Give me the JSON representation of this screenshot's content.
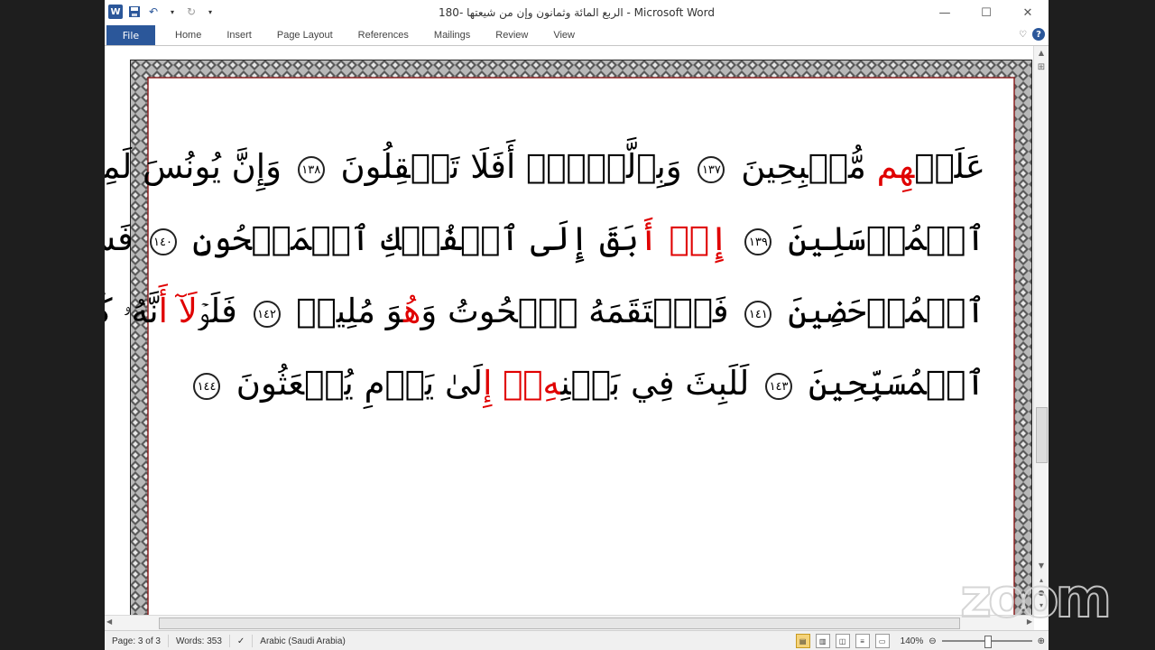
{
  "window": {
    "title": "الربع المائة  وثمانون وإن من شيعتها -180  -  Microsoft Word"
  },
  "ribbon": {
    "file_tab": "File",
    "tabs": [
      "Home",
      "Insert",
      "Page Layout",
      "References",
      "Mailings",
      "Review",
      "View"
    ]
  },
  "document": {
    "lines": [
      {
        "parts": [
          {
            "t": "عَلَيۡ"
          },
          {
            "t": "هِم",
            "red": true
          },
          {
            "t": " مُّصۡبِحِينَ "
          },
          {
            "n": "١٣٧"
          },
          {
            "t": " وَبِٱلَّيۡلِۚ أَفَلَا تَعۡقِلُونَ "
          },
          {
            "n": "١٣٨"
          },
          {
            "t": " وَإِنَّ يُونُسَ لَمِنَ"
          }
        ]
      },
      {
        "parts": [
          {
            "t": "ٱلۡمُرۡسَلِينَ "
          },
          {
            "n": "١٣٩"
          },
          {
            "t": " "
          },
          {
            "t": "إِذۡ",
            "red": true
          },
          {
            "t": " "
          },
          {
            "t": "أَ",
            "red": true
          },
          {
            "t": "بَقَ إِلَى ٱلۡفُلۡكِ ٱلۡمَشۡحُونِ "
          },
          {
            "n": "١٤٠"
          },
          {
            "t": " فَسَاهَمَ فَكَانَ مِنَ"
          }
        ]
      },
      {
        "parts": [
          {
            "t": "ٱلۡمُدۡحَضِينَ "
          },
          {
            "n": "١٤١"
          },
          {
            "t": " فَٱلۡتَقَمَهُ ٱلۡحُوتُ وَ"
          },
          {
            "t": "هُ",
            "red": true
          },
          {
            "t": "وَ مُلِيمٞ "
          },
          {
            "n": "١٤٢"
          },
          {
            "t": " فَلَوۡ"
          },
          {
            "t": "لَآ أَ",
            "red": true
          },
          {
            "t": "نَّهُۥ كَانَ مِنَ"
          }
        ]
      },
      {
        "parts": [
          {
            "t": "ٱلۡمُسَبِّحِينَ "
          },
          {
            "n": "١٤٣"
          },
          {
            "t": " لَلَبِثَ فِي بَطۡنِ"
          },
          {
            "t": "هِۦٓ إِ",
            "red": true
          },
          {
            "t": "لَىٰ يَوۡمِ يُبۡعَثُونَ "
          },
          {
            "n": "١٤٤"
          }
        ]
      }
    ]
  },
  "status": {
    "page": "Page: 3 of 3",
    "words": "Words: 353",
    "language": "Arabic (Saudi Arabia)",
    "zoom": "140%"
  },
  "zoom_slider_level": 0.5,
  "colors": {
    "accent": "#2b579a",
    "red_text": "#e00000"
  }
}
